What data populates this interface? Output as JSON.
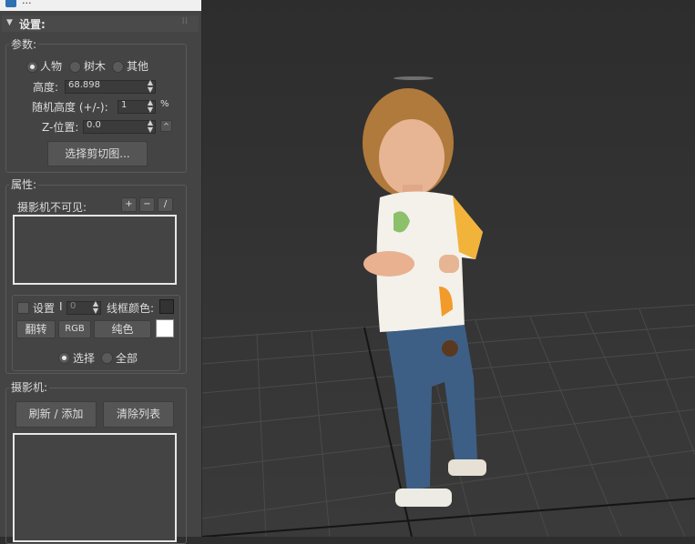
{
  "titlebar": {
    "title": "..."
  },
  "settings": {
    "header": "设置:",
    "params": {
      "label": "参数:",
      "radio_options": [
        "人物",
        "树木",
        "其他"
      ],
      "selected": "人物",
      "height_label": "高度:",
      "height_value": "68.898",
      "random_height_label": "随机高度 (+/-):",
      "random_height_value": "1",
      "percent": "%",
      "z_label": "Z-位置:",
      "z_value": "0.0",
      "select_clip_button": "选择剪切图..."
    },
    "attributes": {
      "label": "属性:",
      "camera_invisible_label": "摄影机不可见:",
      "btn_plus": "+",
      "btn_minus": "−",
      "btn_slash": "/",
      "set_label": "设置",
      "set_value": "I",
      "set_value2": "0",
      "wire_color_label": "线框颜色:",
      "flip_button": "翻转",
      "rgb_button": "RGB",
      "solid_button": "纯色",
      "select_radio": "选择",
      "all_radio": "全部"
    },
    "camera": {
      "label": "摄影机:",
      "refresh_add_button": "刷新 / 添加",
      "clear_list_button": "清除列表"
    }
  },
  "colors": {
    "panel_bg": "#444444",
    "wire_color": "#333333",
    "solid_color": "#ffffff"
  }
}
